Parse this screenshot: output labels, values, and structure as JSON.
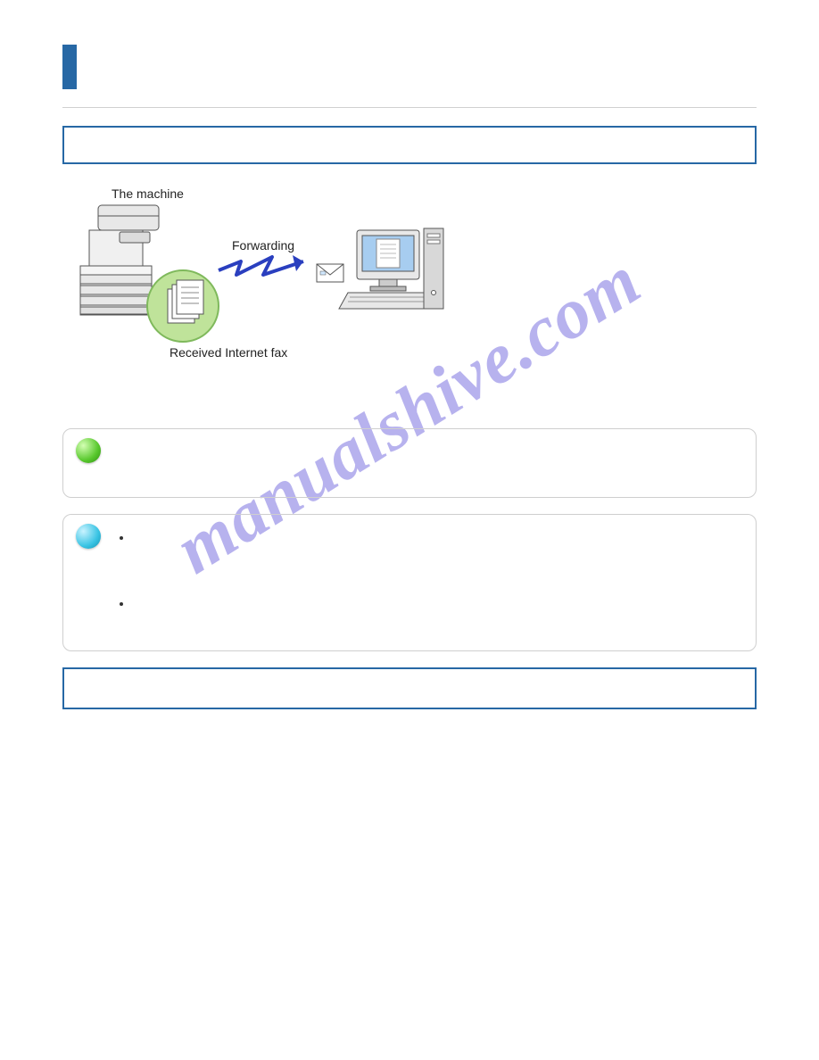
{
  "watermark": "manualshive.com",
  "section_title_box": "",
  "intro_paragraphs": [
    "",
    ""
  ],
  "diagram": {
    "label_machine": "The machine",
    "label_forwarding": "Forwarding",
    "label_received": "Received Internet fax"
  },
  "paragraph_below_diagram": "",
  "note_green": {
    "text": ""
  },
  "note_blue": {
    "items": [
      "",
      ""
    ]
  },
  "step_box": ""
}
